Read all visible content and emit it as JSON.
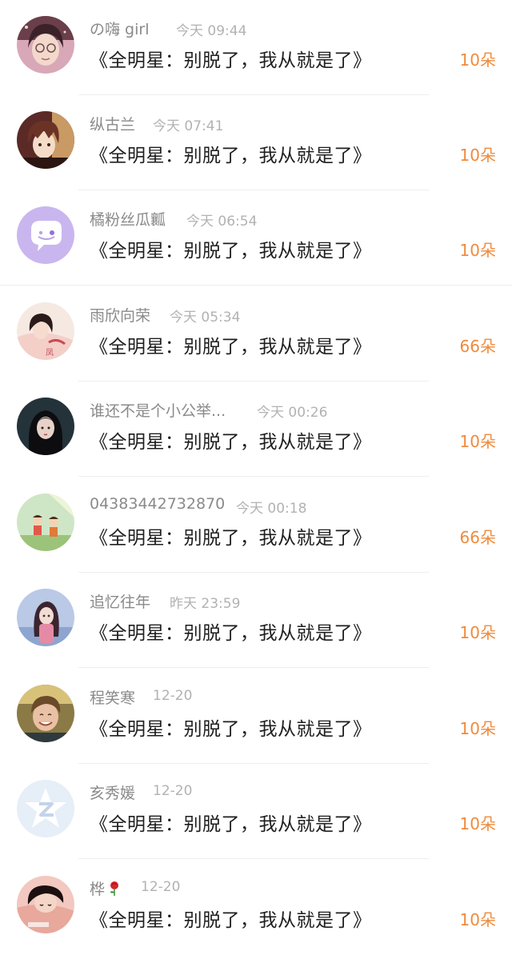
{
  "entries": [
    {
      "name": "の嗨 girl",
      "time": "今天 09:44",
      "message": "《全明星：别脱了，我从就是了》",
      "amount": "10朵",
      "avatar": "woman-glasses-avatar"
    },
    {
      "name": "纵古兰",
      "time": "今天 07:41",
      "message": "《全明星：别脱了，我从就是了》",
      "amount": "10朵",
      "avatar": "anime-boy-avatar"
    },
    {
      "name": "橘粉丝瓜瓤",
      "time": "今天 06:54",
      "message": "《全明星：别脱了，我从就是了》",
      "amount": "10朵",
      "avatar": "chat-bubble-avatar"
    },
    {
      "name": "雨欣向荣",
      "time": "今天 05:34",
      "message": "《全明星：别脱了，我从就是了》",
      "amount": "66朵",
      "avatar": "illustrated-girl-avatar"
    },
    {
      "name": "谁还不是个小公举...",
      "time": "今天 00:26",
      "message": "《全明星：别脱了，我从就是了》",
      "amount": "10朵",
      "avatar": "dark-hair-girl-avatar"
    },
    {
      "name": "04383442732870",
      "time": "今天 00:18",
      "message": "《全明星：别脱了，我从就是了》",
      "amount": "66朵",
      "avatar": "cartoon-kids-avatar"
    },
    {
      "name": "追忆往年",
      "time": "昨天 23:59",
      "message": "《全明星：别脱了，我从就是了》",
      "amount": "10朵",
      "avatar": "anime-girl-avatar"
    },
    {
      "name": "程笑寒",
      "time": "12-20",
      "message": "《全明星：别脱了，我从就是了》",
      "amount": "10朵",
      "avatar": "smiling-person-avatar"
    },
    {
      "name": "亥秀媛",
      "time": "12-20",
      "message": "《全明星：别脱了，我从就是了》",
      "amount": "10朵",
      "avatar": "default-star-avatar"
    },
    {
      "name": "桦",
      "time": "12-20",
      "message": "《全明星：别脱了，我从就是了》",
      "amount": "10朵",
      "avatar": "sleeping-person-avatar",
      "emoji": "rose-icon"
    }
  ],
  "colors": {
    "amount": "#f08a3c",
    "name": "#8a8a8a",
    "time": "#b2b2b2",
    "message": "#1e1e1e",
    "divider": "#eeeeee"
  }
}
